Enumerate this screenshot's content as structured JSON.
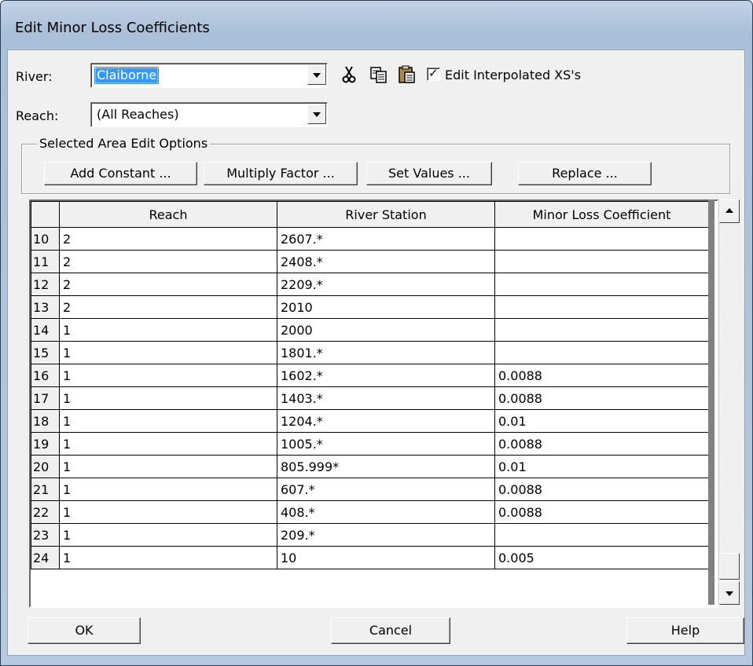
{
  "window": {
    "title": "Edit Minor Loss Coefficients"
  },
  "river": {
    "label": "River:",
    "value": "Claiborne"
  },
  "reach": {
    "label": "Reach:",
    "value": "(All Reaches)"
  },
  "toolbar": {
    "cut_icon": "scissors-icon",
    "copy_icon": "copy-icon",
    "paste_icon": "paste-icon"
  },
  "edit_interpolated": {
    "label": "Edit Interpolated XS's",
    "checked": true
  },
  "selected_area": {
    "legend": "Selected Area Edit Options",
    "add_constant": "Add Constant ...",
    "multiply_factor": "Multiply Factor ...",
    "set_values": "Set Values ...",
    "replace": "Replace ..."
  },
  "table": {
    "columns": [
      "",
      "Reach",
      "River Station",
      "Minor Loss Coefficient"
    ],
    "rows": [
      {
        "n": "10",
        "reach": "2",
        "station": "2607.*",
        "coef": ""
      },
      {
        "n": "11",
        "reach": "2",
        "station": "2408.*",
        "coef": ""
      },
      {
        "n": "12",
        "reach": "2",
        "station": "2209.*",
        "coef": ""
      },
      {
        "n": "13",
        "reach": "2",
        "station": "2010",
        "coef": ""
      },
      {
        "n": "14",
        "reach": "1",
        "station": "2000",
        "coef": ""
      },
      {
        "n": "15",
        "reach": "1",
        "station": "1801.*",
        "coef": ""
      },
      {
        "n": "16",
        "reach": "1",
        "station": "1602.*",
        "coef": "0.0088"
      },
      {
        "n": "17",
        "reach": "1",
        "station": "1403.*",
        "coef": "0.0088"
      },
      {
        "n": "18",
        "reach": "1",
        "station": "1204.*",
        "coef": "0.01"
      },
      {
        "n": "19",
        "reach": "1",
        "station": "1005.*",
        "coef": "0.0088"
      },
      {
        "n": "20",
        "reach": "1",
        "station": "805.999*",
        "coef": "0.01"
      },
      {
        "n": "21",
        "reach": "1",
        "station": "607.*",
        "coef": "0.0088"
      },
      {
        "n": "22",
        "reach": "1",
        "station": "408.*",
        "coef": "0.0088"
      },
      {
        "n": "23",
        "reach": "1",
        "station": "209.*",
        "coef": ""
      },
      {
        "n": "24",
        "reach": "1",
        "station": "10",
        "coef": "0.005"
      }
    ]
  },
  "footer": {
    "ok": "OK",
    "cancel": "Cancel",
    "help": "Help"
  }
}
